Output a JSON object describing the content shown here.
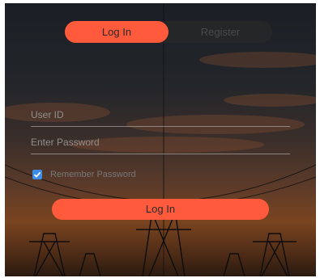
{
  "tabs": {
    "login_label": "Log In",
    "register_label": "Register"
  },
  "form": {
    "user_id_placeholder": "User ID",
    "password_placeholder": "Enter Password",
    "remember_label": "Remember Password",
    "remember_checked": true,
    "submit_label": "Log In"
  },
  "colors": {
    "accent": "#ff5a3c",
    "checkbox": "#3c8ce8"
  }
}
